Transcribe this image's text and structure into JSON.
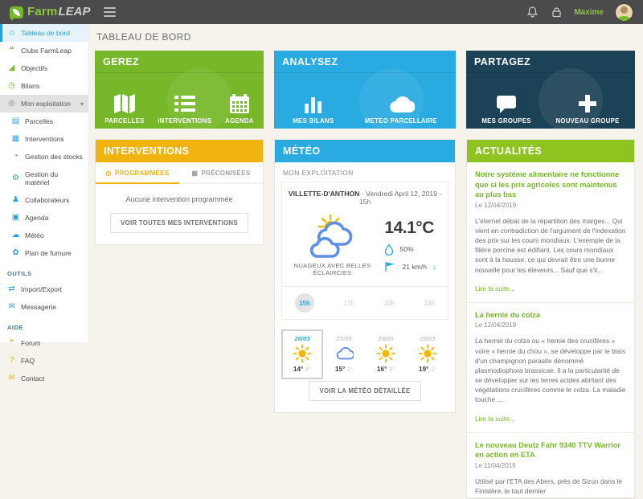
{
  "colors": {
    "brand_green": "#76b82a",
    "accent_blue": "#29abe2",
    "navy": "#1c4257",
    "amber": "#f0b310",
    "news_green": "#8fc320"
  },
  "topbar": {
    "brand_farm": "Farm",
    "brand_leap": "LEAP",
    "username": "Maxime"
  },
  "sidebar": {
    "items": [
      {
        "label": "Tableau de bord"
      },
      {
        "label": "Clubs FarmLeap"
      },
      {
        "label": "Objectifs"
      },
      {
        "label": "Bilans"
      },
      {
        "label": "Mon exploitation"
      }
    ],
    "sub_items": [
      {
        "label": "Parcelles"
      },
      {
        "label": "Interventions"
      },
      {
        "label": "Gestion des stocks"
      },
      {
        "label": "Gestion du matériel"
      },
      {
        "label": "Collaborateurs"
      },
      {
        "label": "Agenda"
      },
      {
        "label": "Météo"
      },
      {
        "label": "Plan de fumure"
      }
    ],
    "outils_label": "OUTILS",
    "outils_items": [
      {
        "label": "Import/Export"
      },
      {
        "label": "Messagerie"
      }
    ],
    "aide_label": "AIDE",
    "aide_items": [
      {
        "label": "Forum"
      },
      {
        "label": "FAQ"
      },
      {
        "label": "Contact"
      }
    ]
  },
  "main": {
    "title": "TABLEAU DE BORD"
  },
  "cards": {
    "gerez": {
      "title": "GEREZ",
      "shortcuts": [
        {
          "label": "PARCELLES"
        },
        {
          "label": "INTERVENTIONS"
        },
        {
          "label": "AGENDA"
        }
      ]
    },
    "analysez": {
      "title": "ANALYSEZ",
      "shortcuts": [
        {
          "label": "MES BILANS"
        },
        {
          "label": "METEO PARCELLAIRE"
        }
      ]
    },
    "partagez": {
      "title": "PARTAGEZ",
      "shortcuts": [
        {
          "label": "MES GROUPES"
        },
        {
          "label": "NOUVEAU GROUPE"
        }
      ]
    }
  },
  "interventions": {
    "title": "INTERVENTIONS",
    "tabs": [
      {
        "label": "PROGRAMMÉES"
      },
      {
        "label": "PRÉCONISÉES"
      }
    ],
    "empty_message": "Aucune intervention programmée",
    "button": "VOIR TOUTES MES INTERVENTIONS"
  },
  "meteo": {
    "title": "MÉTÉO",
    "subtitle": "MON EXPLOITATION",
    "location": "VILLETTE-D'ANTHON",
    "datetime": "- Vendredi April 12, 2019 - 15h",
    "temperature": "14.1°C",
    "humidity": "50%",
    "wind": "21 km/h",
    "condition": "NUAGEUX AVEC BELLES ÉCLAIRCIES",
    "hours": [
      "15h",
      "17h",
      "20h",
      "23h"
    ],
    "forecast": [
      {
        "date": "26/03",
        "icon": "sun",
        "high": "14°",
        "low": "4°"
      },
      {
        "date": "27/03",
        "icon": "cloud",
        "high": "15°",
        "low": "2°"
      },
      {
        "date": "28/03",
        "icon": "sun",
        "high": "16°",
        "low": "3°"
      },
      {
        "date": "29/03",
        "icon": "sun",
        "high": "19°",
        "low": "3°"
      }
    ],
    "button": "VOIR LA MÉTÉO DÉTAILLÉE"
  },
  "actualites": {
    "title": "ACTUALITÉS",
    "read_more": "Lire la suite...",
    "articles": [
      {
        "title": "Notre système alimentaire ne fonctionne que si les prix agricoles sont maintenus au plus bas",
        "date": "Le 12/04/2019",
        "body": "L'éternel débat de la répartition des marges... Qui vient en contradiction de l'argument de l'indexation des prix sur les cours mondiaux. L'exemple de la filière porcine est édifiant. Les cours mondiaux sont à la hausse, ce qui devrait être une bonne nouvelle pour les éleveurs... Sauf que s'il..."
      },
      {
        "title": "La hernie du colza",
        "date": "Le 12/04/2019",
        "body": "La hernie du colza ou « hernie des crucifères » voire « hernie du chou », se développe par le biais d'un champignon parasite dénommé plasmodiophora brassicae. Il a la particularité de se développer sur les terres acides abritant des végétations crucifères comme le colza. La maladie touche ..."
      },
      {
        "title": "Le nouveau Deutz Fahr 9340 TTV Warrior en action en ETA",
        "date": "Le 11/04/2019",
        "body": "Utilisé par l'ETA des Abers, près de Sizun dans le Finistère, le tout dernier"
      }
    ]
  }
}
